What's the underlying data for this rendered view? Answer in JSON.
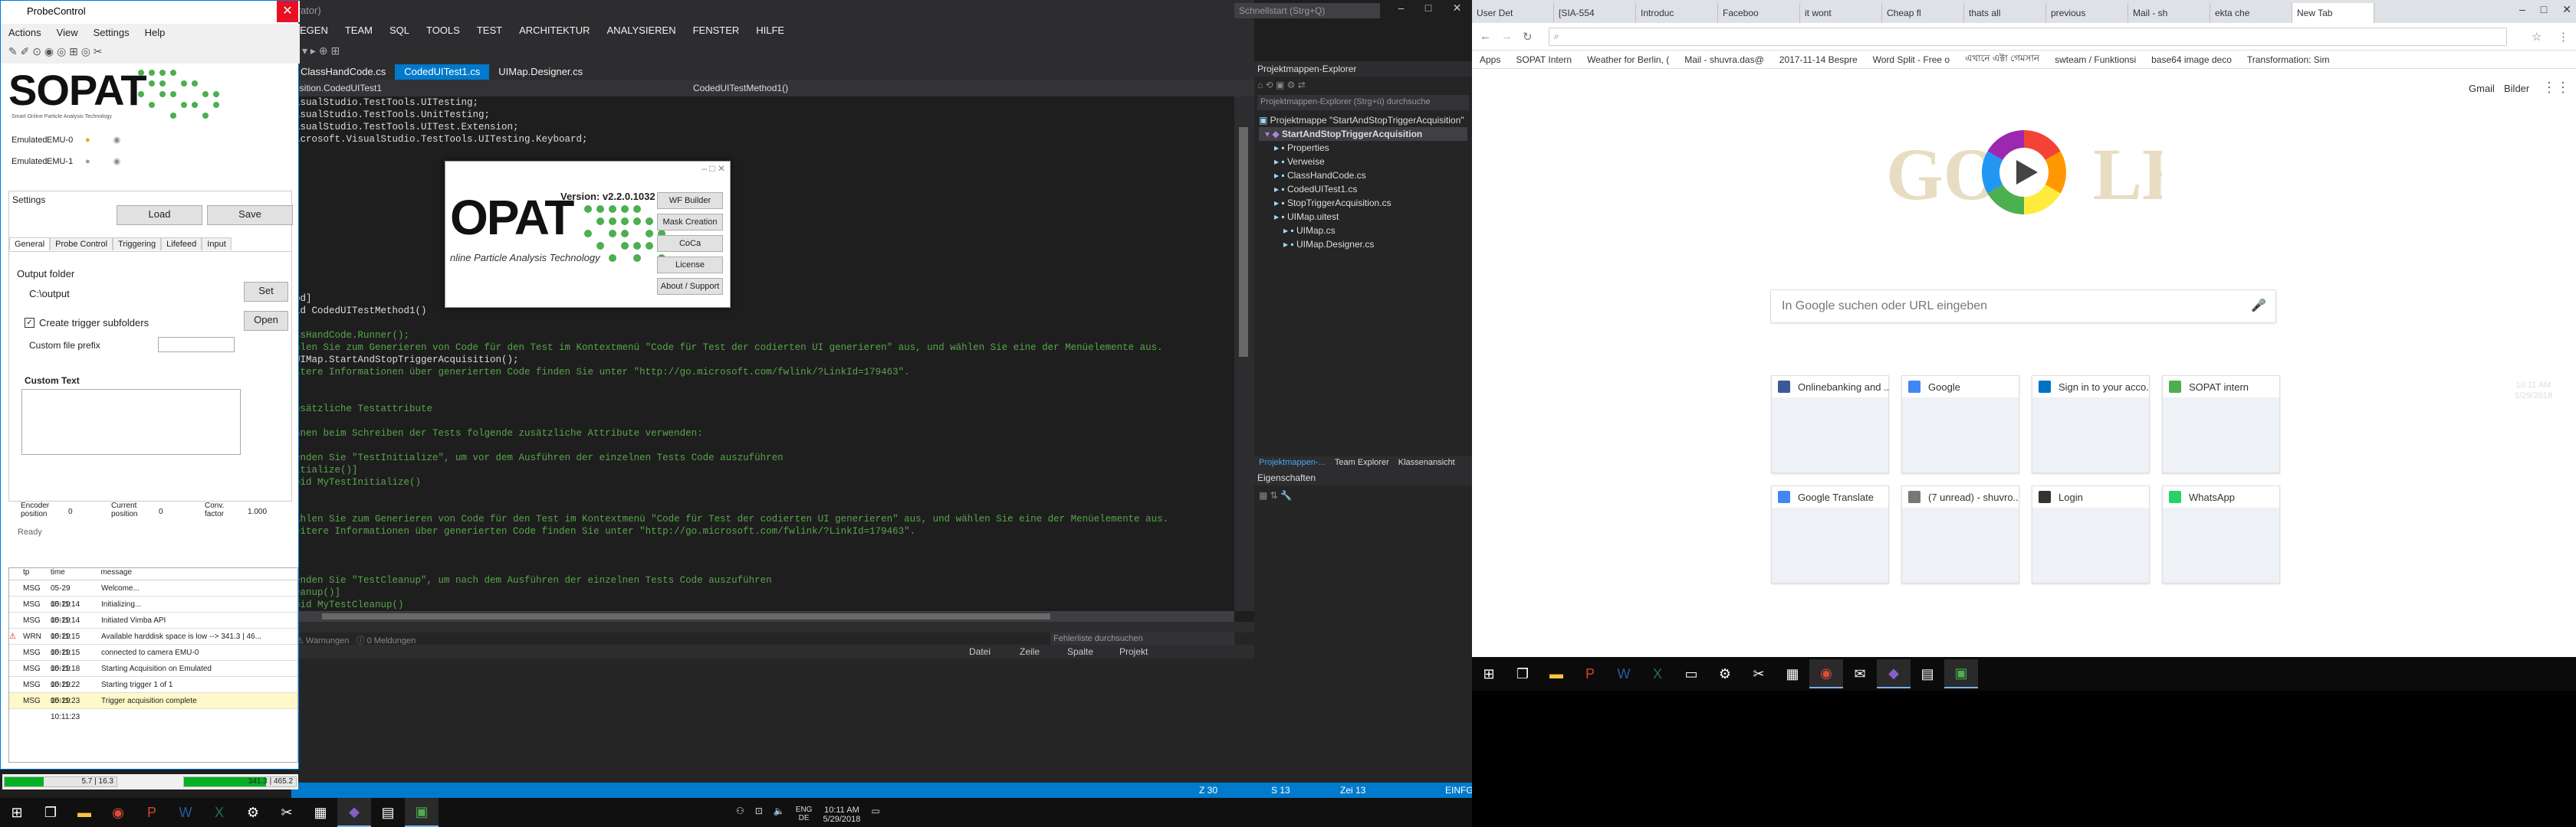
{
  "vs": {
    "title_fragment": "trator)",
    "search_placeholder": "Schnellstart (Strg+Q)",
    "menu": [
      "EGEN",
      "TEAM",
      "SQL",
      "TOOLS",
      "TEST",
      "ARCHITEKTUR",
      "ANALYSIEREN",
      "FENSTER",
      "HILFE"
    ],
    "tabs": [
      "ClassHandCode.cs",
      "CodedUITest1.cs",
      "UIMap.Designer.cs"
    ],
    "nav_left": "osition.CodedUITest1",
    "nav_right": "CodedUITestMethod1()",
    "code_lines": [
      {
        "t": "isualStudio.TestTools.UITesting;",
        "c": "c-tx"
      },
      {
        "t": "isualStudio.TestTools.UnitTesting;",
        "c": "c-tx"
      },
      {
        "t": "isualStudio.TestTools.UITest.Extension;",
        "c": "c-tx"
      },
      {
        "t": "icrosoft.VisualStudio.TestTools.UITesting.Keyboard;",
        "c": "c-tx"
      },
      {
        "t": "",
        "c": "c-tx"
      },
      {
        "t": "",
        "c": "c-tx"
      },
      {
        "t": "",
        "c": "c-tx"
      },
      {
        "t": "",
        "c": "c-tx"
      },
      {
        "t": "",
        "c": "c-tx"
      },
      {
        "t": "",
        "c": "c-tx"
      },
      {
        "t": "",
        "c": "c-tx"
      },
      {
        "t": "",
        "c": "c-tx"
      },
      {
        "t": "",
        "c": "c-tx"
      },
      {
        "t": "",
        "c": "c-tx"
      },
      {
        "t": "",
        "c": "c-tx"
      },
      {
        "t": "",
        "c": "c-tx"
      },
      {
        "t": "od]",
        "c": "c-tx"
      },
      {
        "t": "id CodedUITestMethod1()",
        "c": "c-tx"
      },
      {
        "t": "",
        "c": "c-tx"
      },
      {
        "t": "ssHandCode.Runner();",
        "c": "c-cm"
      },
      {
        "t": "hlen Sie zum Generieren von Code für den Test im Kontextmenü \"Code für Test der codierten UI generieren\" aus, und wählen Sie eine der Menüelemente aus.",
        "c": "c-cm"
      },
      {
        "t": "UIMap.StartAndStopTriggerAcquisition();",
        "c": "c-tx"
      },
      {
        "t": "itere Informationen über generierten Code finden Sie unter \"http://go.microsoft.com/fwlink/?LinkId=179463\".",
        "c": "c-cm"
      },
      {
        "t": "",
        "c": "c-tx"
      },
      {
        "t": "",
        "c": "c-tx"
      },
      {
        "t": "usätzliche Testattribute",
        "c": "c-cm"
      },
      {
        "t": "",
        "c": "c-tx"
      },
      {
        "t": "nnen beim Schreiben der Tests folgende zusätzliche Attribute verwenden:",
        "c": "c-cm"
      },
      {
        "t": "",
        "c": "c-tx"
      },
      {
        "t": "enden Sie \"TestInitialize\", um vor dem Ausführen der einzelnen Tests Code auszuführen",
        "c": "c-cm"
      },
      {
        "t": "itialize()]",
        "c": "c-cm"
      },
      {
        "t": "oid MyTestInitialize()",
        "c": "c-cm"
      },
      {
        "t": "",
        "c": "c-tx"
      },
      {
        "t": "",
        "c": "c-tx"
      },
      {
        "t": "ählen Sie zum Generieren von Code für den Test im Kontextmenü \"Code für Test der codierten UI generieren\" aus, und wählen Sie eine der Menüelemente aus.",
        "c": "c-cm"
      },
      {
        "t": "eitere Informationen über generierten Code finden Sie unter \"http://go.microsoft.com/fwlink/?LinkId=179463\".",
        "c": "c-cm"
      },
      {
        "t": "",
        "c": "c-tx"
      },
      {
        "t": "",
        "c": "c-tx"
      },
      {
        "t": "",
        "c": "c-tx"
      },
      {
        "t": "enden Sie \"TestCleanup\", um nach dem Ausführen der einzelnen Tests Code auszuführen",
        "c": "c-cm"
      },
      {
        "t": "eanup()]",
        "c": "c-cm"
      },
      {
        "t": "oid MyTestCleanup()",
        "c": "c-cm"
      }
    ],
    "err_search": "Fehlerliste durchsuchen",
    "err_warnings": "Warnungen",
    "err_messages": "0 Meldungen",
    "err_cols": [
      "Datei",
      "Zeile",
      "Spalte",
      "Projekt"
    ],
    "status": {
      "z": "Z 30",
      "s": "S 13",
      "zei": "Zei 13",
      "mode": "EINFG"
    },
    "solexp": {
      "title": "Projektmappen-Explorer",
      "search": "Projektmappen-Explorer (Strg+ü) durchsuche",
      "items": [
        "Projektmappe \"StartAndStopTriggerAcquisition\"",
        "StartAndStopTriggerAcquisition",
        "Properties",
        "Verweise",
        "ClassHandCode.cs",
        "CodedUITest1.cs",
        "StopTriggerAcquisition.cs",
        "UIMap.uitest",
        "UIMap.cs",
        "UIMap.Designer.cs"
      ],
      "tabs": [
        "Projektmappen-...",
        "Team Explorer",
        "Klassenansicht"
      ]
    },
    "props_title": "Eigenschaften"
  },
  "probe": {
    "title": "ProbeControl",
    "menu": [
      "Actions",
      "View",
      "Settings",
      "Help"
    ],
    "logo_text": "SOPAT",
    "logo_sub": "Smart Online Particle Analysis Technology",
    "emulated": [
      {
        "label": "Emulated",
        "dev": "EMU-0"
      },
      {
        "label": "Emulated",
        "dev": "EMU-1"
      }
    ],
    "settings_label": "Settings",
    "load": "Load",
    "save": "Save",
    "tabs": [
      "General",
      "Probe Control",
      "Triggering",
      "Lifefeed",
      "Input"
    ],
    "output_folder_label": "Output folder",
    "output_folder_value": "C:\\output",
    "set": "Set",
    "open": "Open",
    "create_trigger": "Create trigger subfolders",
    "custom_prefix": "Custom file prefix",
    "custom_text": "Custom Text",
    "encoder_label": "Encoder position",
    "encoder_val": "0",
    "current_label": "Current position",
    "current_val": "0",
    "conv_label": "Conv. factor",
    "conv_val": "1.000",
    "ready": "Ready",
    "log_cols": [
      "tp",
      "time",
      "message"
    ],
    "log": [
      {
        "tp": "MSG",
        "time": "05-29 10:11:14",
        "msg": "Welcome...",
        "warn": false
      },
      {
        "tp": "MSG",
        "time": "05-29 10:11:14",
        "msg": "Initializing...",
        "warn": false
      },
      {
        "tp": "MSG",
        "time": "05-29 10:11:15",
        "msg": "Initiated Vimba API",
        "warn": false
      },
      {
        "tp": "WRN",
        "time": "05-29 10:11:15",
        "msg": "Available harddisk space is low --> 341.3 | 46...",
        "warn": true
      },
      {
        "tp": "MSG",
        "time": "05-29 10:11:18",
        "msg": "connected to camera EMU-0",
        "warn": false
      },
      {
        "tp": "MSG",
        "time": "05-29 10:11:22",
        "msg": "Starting Acquisition on Emulated",
        "warn": false
      },
      {
        "tp": "MSG",
        "time": "05-29 10:11:23",
        "msg": "Starting trigger 1 of 1",
        "warn": false
      },
      {
        "tp": "MSG",
        "time": "05-29 10:11:23",
        "msg": "Trigger acquisition complete",
        "warn": false
      }
    ],
    "bar1": "5.7 | 16.3",
    "bar2": "341.3 | 465.2",
    "bar1_fill": 0.35,
    "bar2_fill": 0.73
  },
  "about": {
    "logo": "OPAT",
    "sub": "nline Particle Analysis Technology",
    "version": "Version: v2.2.0.1032",
    "buttons": [
      "WF Builder",
      "Mask Creation",
      "CoCa",
      "License",
      "About / Support"
    ]
  },
  "taskbar_left": {
    "lang": "ENG",
    "region": "DE",
    "time": "10:11 AM",
    "date": "5/29/2018"
  },
  "chrome": {
    "tabs": [
      "User Det",
      "[SIA-554",
      "Introduc",
      "Faceboo",
      "it wont",
      "Cheap fl",
      "thats all",
      "previous",
      "Mail - sh",
      "ekta che",
      "New Tab"
    ],
    "bookmarks": [
      "Apps",
      "SOPAT Intern",
      "Weather for Berlin, (",
      "Mail - shuvra.das@",
      "2017-11-14 Bespre",
      "Word Split - Free o",
      "এখানে এক্টা গেমসান",
      "swteam / Funktionsi",
      "base64 image deco",
      "Transformation: Sim"
    ],
    "gmail": "Gmail",
    "images": "Bilder",
    "search_placeholder": "In Google suchen oder URL eingeben",
    "tiles": [
      "Onlinebanking and ...",
      "Google",
      "Sign in to your acco...",
      "SOPAT intern",
      "Google Translate",
      "(7 unread) - shuvro...",
      "Login",
      "WhatsApp"
    ]
  },
  "taskbar_right": {
    "time": "10:11 AM",
    "date": "5/29/2018"
  }
}
